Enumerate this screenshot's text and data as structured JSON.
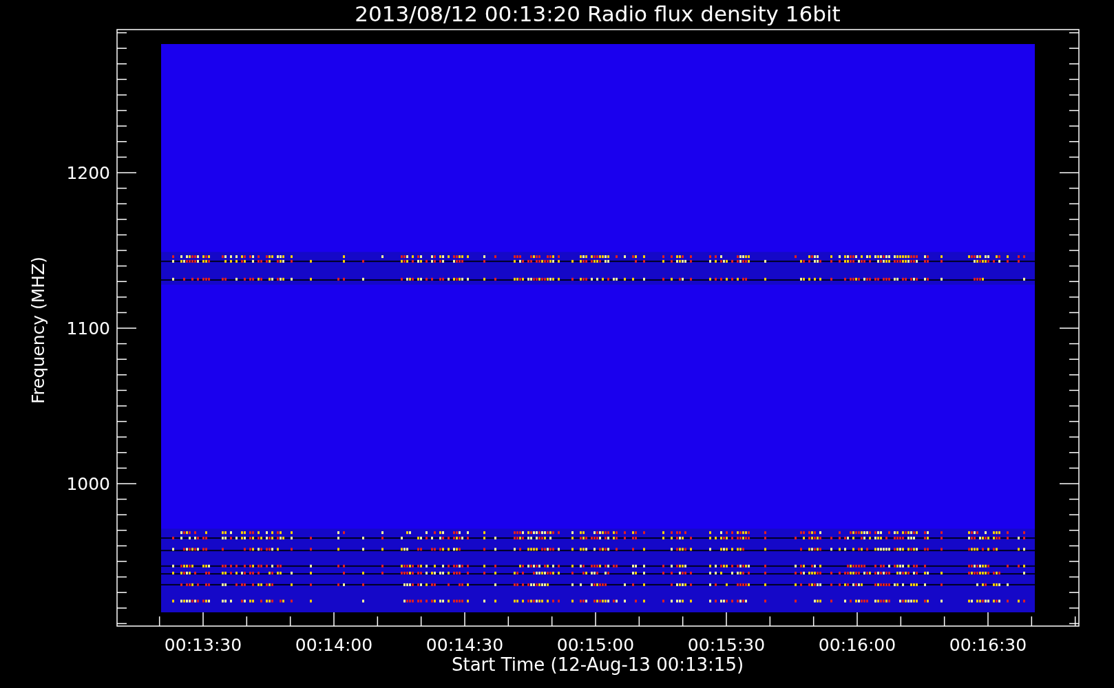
{
  "plot": {
    "title": "2013/08/12 00:13:20 Radio flux density 16bit",
    "xlabel": "Start Time (12-Aug-13 00:13:15)",
    "ylabel": "Frequency (MHZ)",
    "xticks": [
      "00:13:30",
      "00:14:00",
      "00:14:30",
      "00:15:00",
      "00:15:30",
      "00:16:00",
      "00:16:30"
    ],
    "yticks": [
      "1200",
      "1100",
      "1000"
    ]
  }
}
